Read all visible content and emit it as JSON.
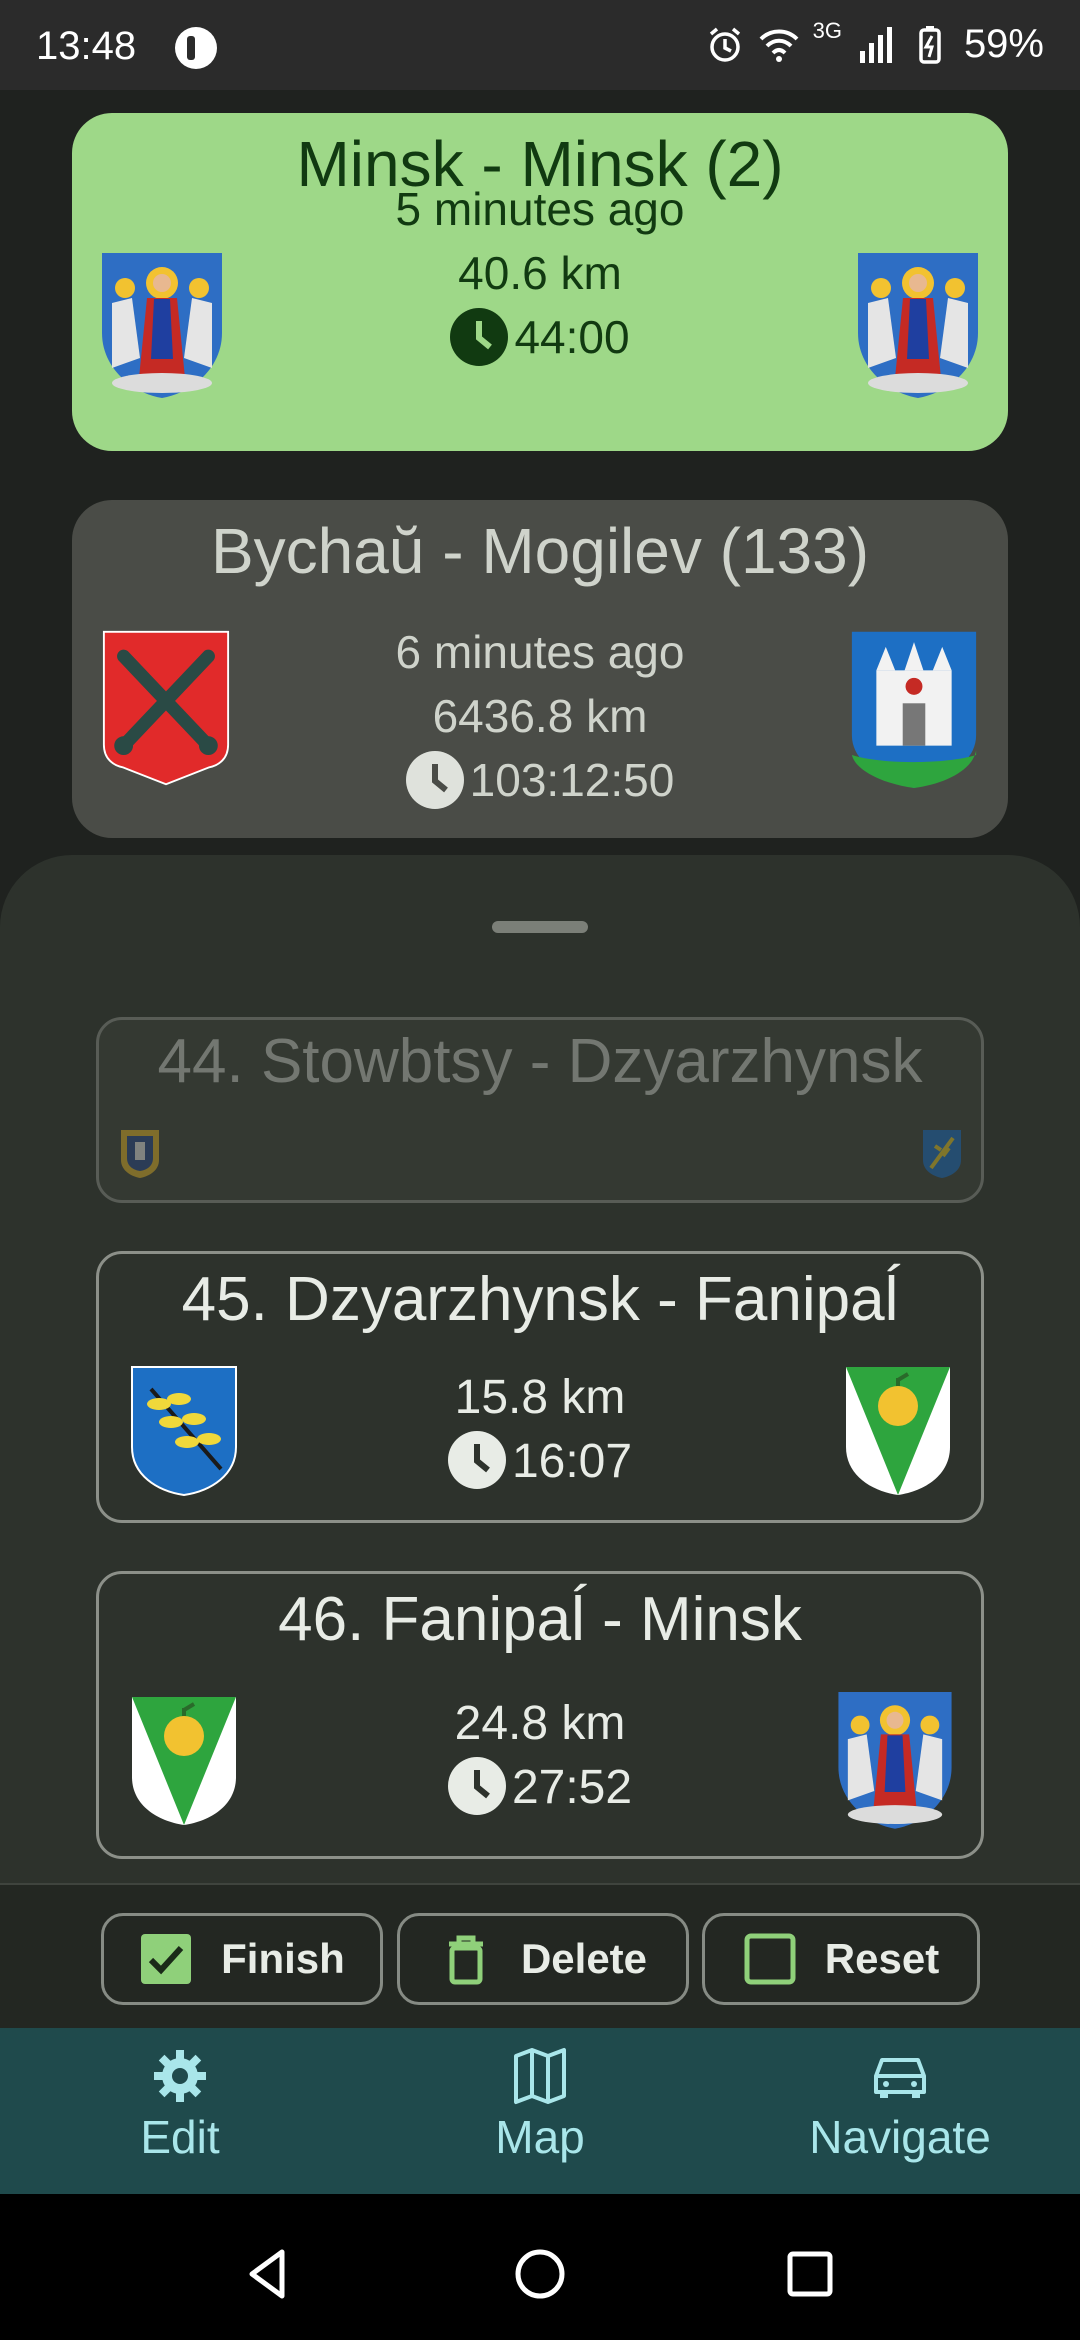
{
  "status_bar": {
    "time": "13:48",
    "network": "3G",
    "battery": "59%"
  },
  "current_route": {
    "title": "Minsk - Minsk (2)",
    "time_ago": "5 minutes ago",
    "distance": "40.6 km",
    "duration": "44:00",
    "accent": "#9ed888"
  },
  "next_route": {
    "title": "Bychaŭ - Mogilev (133)",
    "time_ago": "6 minutes ago",
    "distance": "6436.8 km",
    "duration": "103:12:50"
  },
  "legs": [
    {
      "title": "44. Stowbtsy - Dzyarzhynsk",
      "distance": "",
      "duration": ""
    },
    {
      "title": "45. Dzyarzhynsk - Fanipaĺ",
      "distance": "15.8 km",
      "duration": "16:07"
    },
    {
      "title": "46. Fanipaĺ - Minsk",
      "distance": "24.8 km",
      "duration": "27:52"
    }
  ],
  "actions": {
    "finish": "Finish",
    "delete": "Delete",
    "reset": "Reset"
  },
  "nav": {
    "edit": "Edit",
    "map": "Map",
    "navigate": "Navigate"
  },
  "icons": [
    "alarm-icon",
    "wifi-icon",
    "signal-icon",
    "battery-icon",
    "clock-icon",
    "checkbox-checked-icon",
    "trash-icon",
    "checkbox-empty-icon",
    "gear-icon",
    "map-icon",
    "car-icon"
  ]
}
